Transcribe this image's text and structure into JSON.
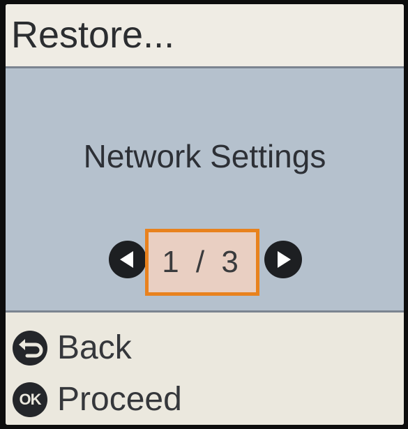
{
  "header": {
    "title": "Restore..."
  },
  "main": {
    "setting_name": "Network Settings",
    "pager": {
      "current": 1,
      "total": 3,
      "label": "1 / 3",
      "prev_icon": "left-arrow-icon",
      "next_icon": "right-arrow-icon"
    }
  },
  "footer": {
    "back": {
      "icon": "back-icon",
      "label": "Back"
    },
    "proceed": {
      "icon": "ok-icon",
      "icon_text": "OK",
      "label": "Proceed"
    }
  },
  "colors": {
    "content_background": "#b5c1cd",
    "page_box_border": "#e8821e",
    "page_box_fill": "#e9cfc2",
    "header_background": "#efece4",
    "divider": "#7b8490"
  }
}
